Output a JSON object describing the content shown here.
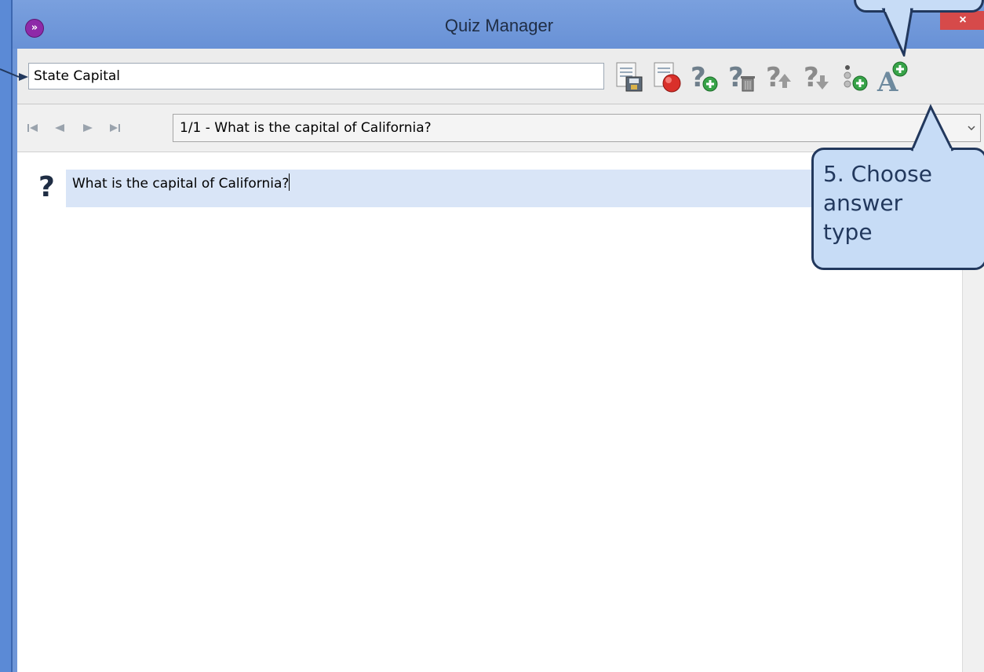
{
  "window": {
    "title": "Quiz Manager",
    "close_glyph": "×"
  },
  "app_icon": {
    "name": "app-logo-icon",
    "glyph": "»",
    "color": "#8e2aa8"
  },
  "quiz_name": {
    "value": "State Capital"
  },
  "toolbar": {
    "icons": [
      "save-quiz-icon",
      "record-quiz-icon",
      "add-question-icon",
      "delete-question-icon",
      "move-question-up-icon",
      "move-question-down-icon",
      "add-answer-type-icon",
      "add-answer-icon"
    ]
  },
  "navigation": {
    "buttons": [
      "first-icon",
      "previous-icon",
      "next-icon",
      "last-icon"
    ],
    "selected_question": "1/1 - What is the capital of California?"
  },
  "question": {
    "text": "What is the capital of California?"
  },
  "callouts": {
    "choose_answer_type": "5. Choose\nanswer\ntype"
  },
  "colors": {
    "window_frame": "#6e96d8",
    "close_button": "#d64a4a",
    "callout_fill": "#c7dcf6",
    "callout_border": "#22385d",
    "question_field": "#d9e5f7"
  }
}
